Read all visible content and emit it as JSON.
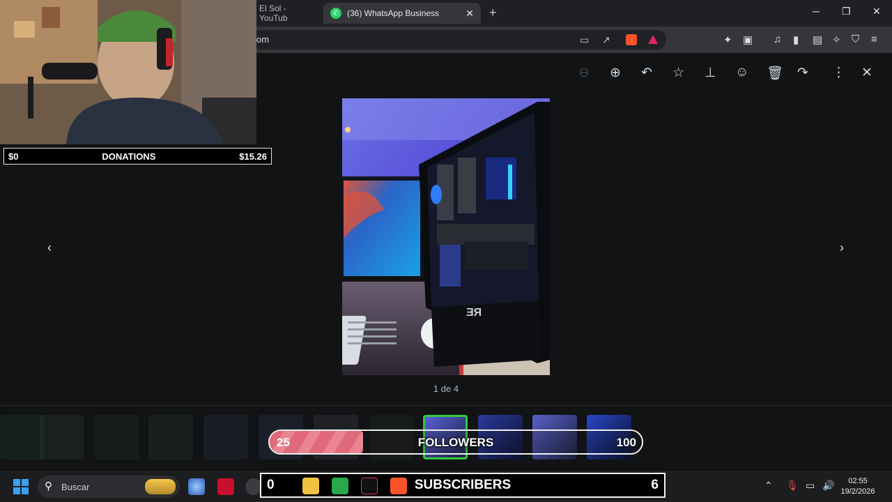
{
  "browser": {
    "tabs": [
      {
        "label": "El Sol - YouTub",
        "active": false
      },
      {
        "label": "(36) WhatsApp Business",
        "active": true
      }
    ],
    "new_tab_symbol": "+",
    "address": {
      "url_fragment": "om"
    },
    "window_controls": [
      "minimize",
      "restore",
      "close"
    ]
  },
  "webcam": {
    "description_icon": "streamer-webcam"
  },
  "donations": {
    "min": "$0",
    "label": "DONATIONS",
    "current": "$15.26"
  },
  "viewer": {
    "toolbar": [
      "zoom-out-icon",
      "zoom-in-icon",
      "reply-icon",
      "star-icon",
      "pin-icon",
      "emoji-icon",
      "delete-icon",
      "forward-icon",
      "more-icon",
      "close-icon"
    ],
    "counter": "1 de 4",
    "thumbnails_selected_index": 8
  },
  "followers": {
    "current": "25",
    "label": "FOLLOWERS",
    "goal": "100",
    "progress": 0.25
  },
  "subscribers": {
    "current": "0",
    "label": "SUBSCRIBERS",
    "goal": "6"
  },
  "taskbar": {
    "search_placeholder": "Buscar",
    "clock_time": "02:55",
    "clock_date": "19/2/2026"
  },
  "colors": {
    "accent_green": "#2ecc40",
    "whatsapp": "#25d366",
    "followers_bar": "#e16a7a"
  }
}
